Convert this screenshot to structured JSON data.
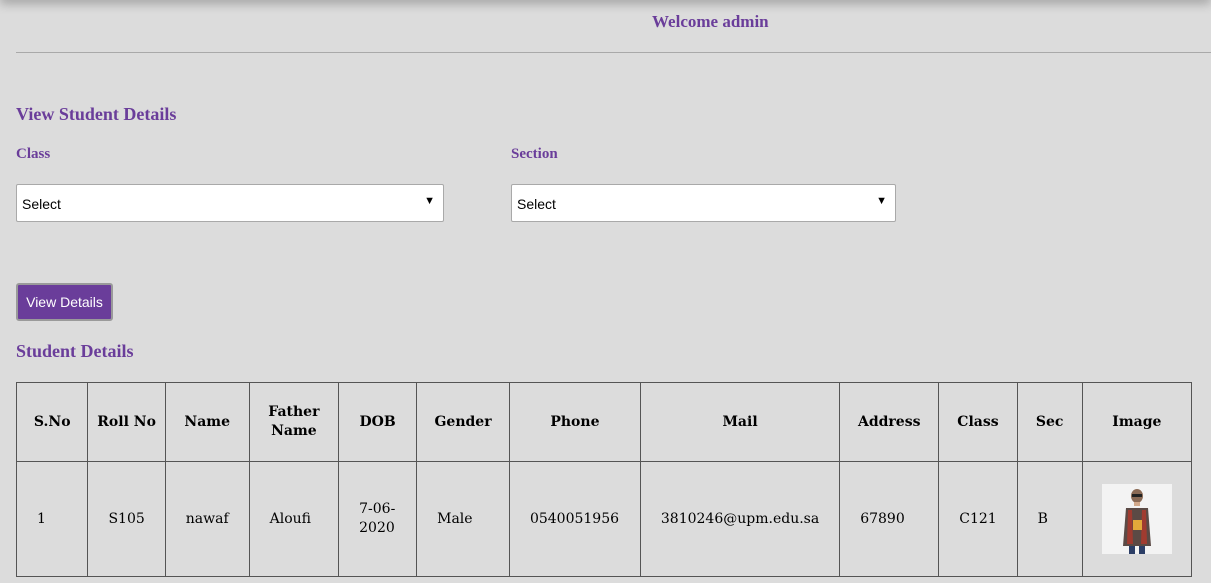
{
  "header": {
    "welcome": "Welcome admin"
  },
  "filters": {
    "title": "View Student Details",
    "class_label": "Class",
    "class_value": "Select",
    "section_label": "Section",
    "section_value": "Select",
    "button_label": "View Details"
  },
  "details": {
    "title": "Student Details",
    "columns": [
      "S.No",
      "Roll No",
      "Name",
      "Father Name",
      "DOB",
      "Gender",
      "Phone",
      "Mail",
      "Address",
      "Class",
      "Sec",
      "Image"
    ],
    "rows": [
      {
        "sno": "1",
        "roll": "S105",
        "name": "nawaf",
        "father": "Aloufi",
        "dob": "7-06-2020",
        "gender": "Male",
        "phone": "0540051956",
        "mail": "3810246@upm.edu.sa",
        "address": "67890",
        "class": "C121",
        "sec": "B",
        "image": "student-photo"
      }
    ]
  },
  "colors": {
    "accent": "#6a3d9a",
    "background": "#dcdcdc"
  }
}
